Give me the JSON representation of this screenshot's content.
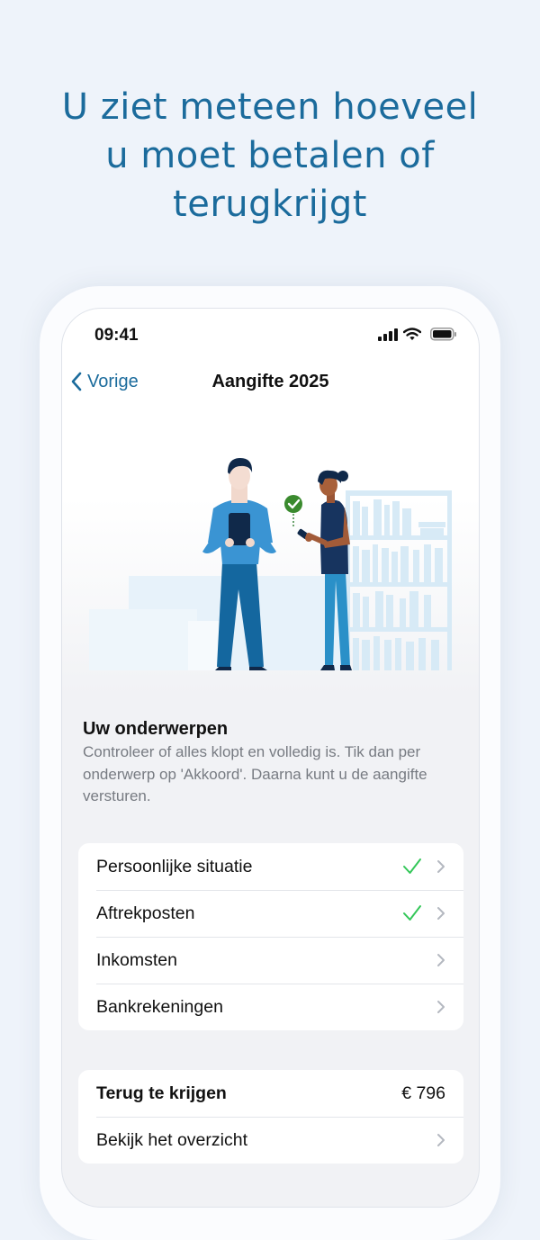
{
  "headline": [
    "U ziet meteen hoeveel",
    "u moet betalen of",
    "terugkrijgt"
  ],
  "status": {
    "time": "09:41"
  },
  "nav": {
    "back_label": "Vorige",
    "title": "Aangifte 2025"
  },
  "section": {
    "title": "Uw onderwerpen",
    "description": "Controleer of alles klopt en volledig is. Tik dan per onderwerp op 'Akkoord'. Daarna kunt u de aangifte versturen."
  },
  "topics": [
    {
      "label": "Persoonlijke situatie",
      "checked": true
    },
    {
      "label": "Aftrekposten",
      "checked": true
    },
    {
      "label": "Inkomsten",
      "checked": false
    },
    {
      "label": "Bankrekeningen",
      "checked": false
    }
  ],
  "summary": {
    "refund_label": "Terug te krijgen",
    "refund_amount": "€ 796",
    "overview_label": "Bekijk het overzicht"
  },
  "colors": {
    "accent": "#1b6b9c",
    "check": "#34c759",
    "background": "#eef3fa"
  }
}
